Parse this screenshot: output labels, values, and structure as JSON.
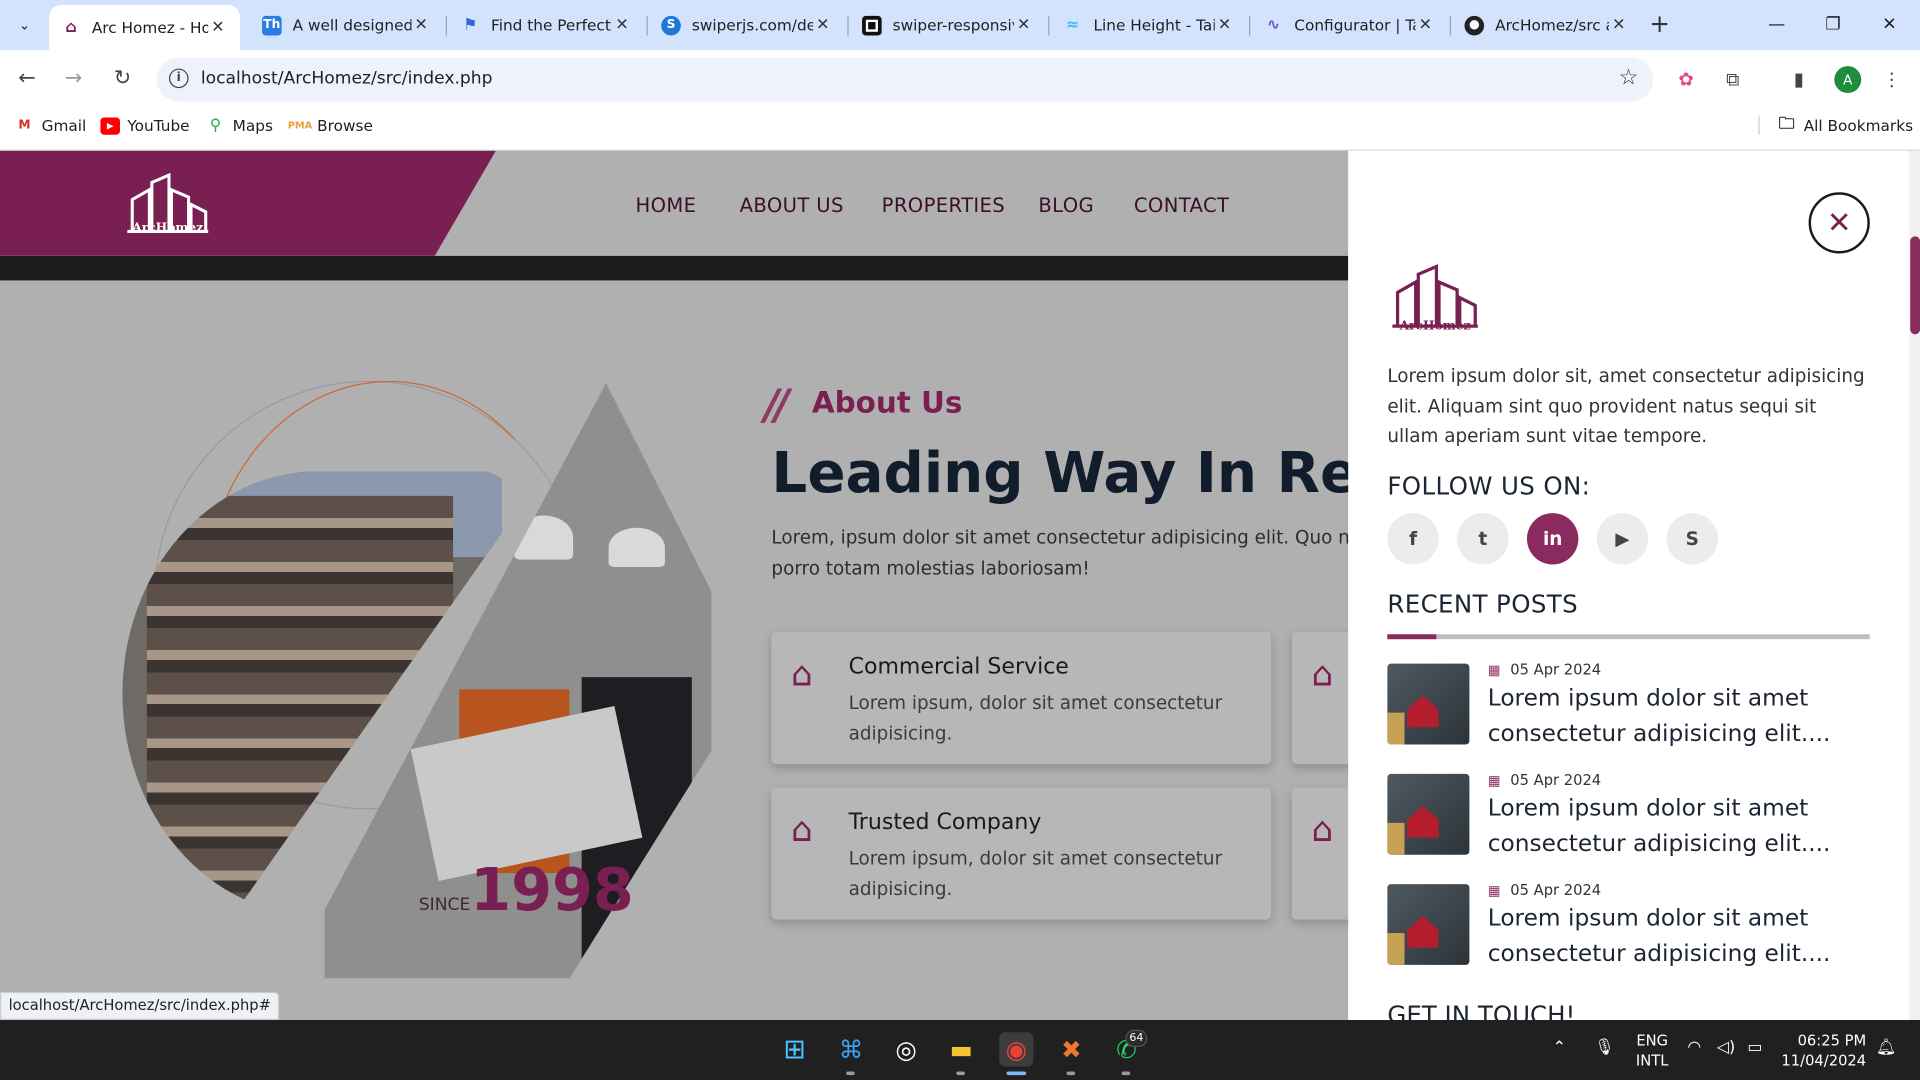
{
  "browser": {
    "tabs": [
      {
        "title": "Arc Homez - Ho",
        "favicon": "archomez-icon",
        "active": true
      },
      {
        "title": "A well designed",
        "favicon": "th-icon"
      },
      {
        "title": "Find the Perfect",
        "favicon": "flag-icon"
      },
      {
        "title": "swiperjs.com/de",
        "favicon": "swiper-icon"
      },
      {
        "title": "swiper-responsiv",
        "favicon": "codesandbox-icon"
      },
      {
        "title": "Line Height - Tai",
        "favicon": "tailwind-icon"
      },
      {
        "title": "Configurator | Ta",
        "favicon": "wave-icon"
      },
      {
        "title": "ArcHomez/src at",
        "favicon": "github-icon"
      }
    ],
    "url": "localhost/ArcHomez/src/index.php",
    "profile_initial": "A",
    "bookmarks": [
      {
        "label": "Gmail",
        "icon": "gmail-icon"
      },
      {
        "label": "YouTube",
        "icon": "youtube-icon"
      },
      {
        "label": "Maps",
        "icon": "maps-icon"
      },
      {
        "label": "Browse",
        "icon": "phpmyadmin-icon"
      }
    ],
    "all_bookmarks": "All Bookmarks",
    "status_url": "localhost/ArcHomez/src/index.php#"
  },
  "site": {
    "logo_text": "ArcHomez",
    "nav": [
      "HOME",
      "ABOUT US",
      "PROPERTIES",
      "BLOG",
      "CONTACT"
    ],
    "colors": {
      "brand": "#7a1f51",
      "accent": "#8b2a5e"
    },
    "about": {
      "tag": "About Us",
      "title": "Leading Way In Rea",
      "text": "Lorem, ipsum dolor sit amet consectetur adipisicing elit. Quo nulla porro totam molestias laboriosam!",
      "since_label": "SINCE",
      "since_year": "1998"
    },
    "services": [
      {
        "title": "Commercial Service",
        "desc": "Lorem ipsum, dolor sit amet consectetur adipisicing."
      },
      {
        "title": "Trusted Company",
        "desc": "Lorem ipsum, dolor sit amet consectetur adipisicing."
      }
    ]
  },
  "offcanvas": {
    "logo_text": "ArcHomez",
    "description": "Lorem ipsum dolor sit, amet consectetur adipisicing elit. Aliquam sint quo provident natus sequi sit ullam aperiam sunt vitae tempore.",
    "follow_heading": "FOLLOW US ON:",
    "socials": [
      {
        "name": "facebook",
        "glyph": "f"
      },
      {
        "name": "twitter",
        "glyph": "t"
      },
      {
        "name": "linkedin",
        "glyph": "in",
        "active": true
      },
      {
        "name": "youtube",
        "glyph": "▶"
      },
      {
        "name": "skype",
        "glyph": "S"
      }
    ],
    "recent_heading": "RECENT POSTS",
    "posts": [
      {
        "date": "05 Apr 2024",
        "title": "Lorem ipsum dolor sit amet consectetur adipisicing elit...."
      },
      {
        "date": "05 Apr 2024",
        "title": "Lorem ipsum dolor sit amet consectetur adipisicing elit...."
      },
      {
        "date": "05 Apr 2024",
        "title": "Lorem ipsum dolor sit amet consectetur adipisicing elit...."
      }
    ],
    "get_in_touch": "GET IN TOUCH!"
  },
  "taskbar": {
    "lang_line1": "ENG",
    "lang_line2": "INTL",
    "time": "06:25 PM",
    "date": "11/04/2024",
    "whatsapp_badge": "64"
  }
}
